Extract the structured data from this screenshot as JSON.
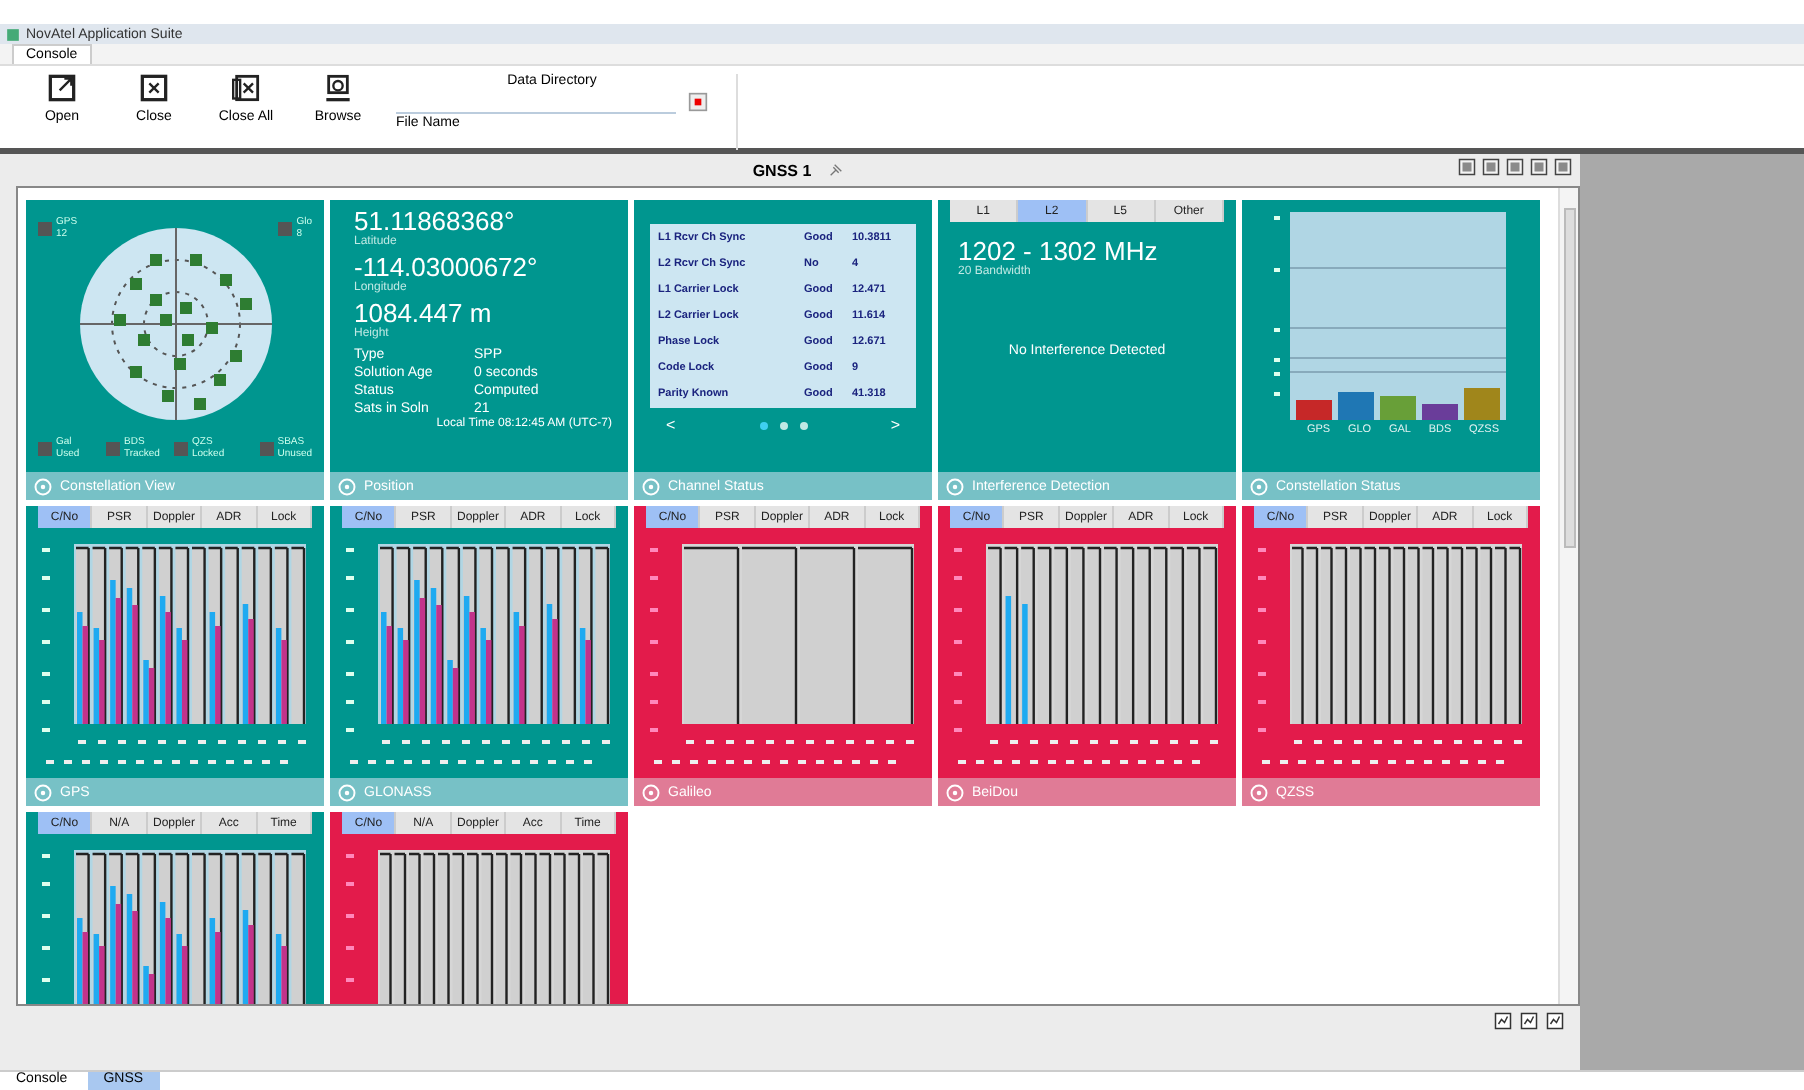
{
  "window": {
    "title": "NovAtel Application Suite"
  },
  "ribbon_tabs": [
    {
      "label": "Console",
      "selected": true
    }
  ],
  "toolbar": {
    "buttons": [
      {
        "label": "Open"
      },
      {
        "label": "Close"
      },
      {
        "label": "Close All"
      },
      {
        "label": "Browse"
      }
    ],
    "file_label": "File Name",
    "directory_label": "Data Directory"
  },
  "document": {
    "title": "GNSS 1"
  },
  "panels": [
    {
      "kind": "skyplot",
      "color": "#00968f",
      "footer": "Constellation View",
      "legend": [
        {
          "label": "GPS",
          "sub": "12"
        },
        {
          "label": "Glo",
          "sub": "8"
        },
        {
          "label": "Gal",
          "sub": "Used"
        },
        {
          "label": "BDS",
          "sub": "Tracked"
        },
        {
          "label": "QZS",
          "sub": "Locked"
        },
        {
          "label": "SBAS",
          "sub": "Unused"
        }
      ]
    },
    {
      "kind": "position",
      "color": "#00968f",
      "footer": "Position",
      "lat": "51.11868368°",
      "lat_label": "Latitude",
      "lon": "-114.03000672°",
      "lon_label": "Longitude",
      "height": "1084.447 m",
      "height_label": "Height",
      "rows": [
        {
          "key": "Type",
          "value": "SPP"
        },
        {
          "key": "Solution Age",
          "value": "0 seconds"
        },
        {
          "key": "Status",
          "value": "Computed"
        },
        {
          "key": "Sats in Soln",
          "value": "21"
        }
      ],
      "time": "Local Time 08:12:45 AM (UTC-7)"
    },
    {
      "kind": "channels",
      "color": "#00968f",
      "footer": "Channel Status",
      "rows": [
        [
          "L1 Rcvr Ch Sync",
          "Good",
          "10.3811"
        ],
        [
          "L2 Rcvr Ch Sync",
          "No",
          "4"
        ],
        [
          "L1 Carrier Lock",
          "Good",
          "12.471"
        ],
        [
          "L2 Carrier Lock",
          "Good",
          "11.614"
        ],
        [
          "Phase Lock",
          "Good",
          "12.671"
        ],
        [
          "Code Lock",
          "Good",
          "9"
        ],
        [
          "Parity Known",
          "Good",
          "41.318"
        ]
      ],
      "pager": {
        "prev": "<",
        "next": ">",
        "pages": [
          {
            "selected": true
          },
          {
            "selected": false
          },
          {
            "selected": false
          }
        ]
      }
    },
    {
      "kind": "interference",
      "color": "#00968f",
      "footer": "Interference Detection",
      "tabs": [
        {
          "label": "L1",
          "selected": false
        },
        {
          "label": "L2",
          "selected": true
        },
        {
          "label": "L5",
          "selected": false
        },
        {
          "label": "Other",
          "selected": false
        }
      ],
      "band": "1202 - 1302 MHz",
      "band_label": "20 Bandwidth",
      "message": "No Interference Detected"
    },
    {
      "kind": "bars",
      "color": "#00968f",
      "footer": "Constellation Status",
      "labels": [
        "GPS",
        "GLO",
        "GAL",
        "BDS",
        "QZSS"
      ]
    },
    {
      "kind": "signals",
      "color": "#00968f",
      "footer": "GPS",
      "tabs": [
        {
          "label": "C/No",
          "selected": true
        },
        {
          "label": "PSR",
          "selected": false
        },
        {
          "label": "Doppler",
          "selected": false
        },
        {
          "label": "ADR",
          "selected": false
        },
        {
          "label": "Lock",
          "selected": false
        }
      ]
    },
    {
      "kind": "signals",
      "color": "#00968f",
      "footer": "GLONASS",
      "tabs": [
        {
          "label": "C/No",
          "selected": true
        },
        {
          "label": "PSR",
          "selected": false
        },
        {
          "label": "Doppler",
          "selected": false
        },
        {
          "label": "ADR",
          "selected": false
        },
        {
          "label": "Lock",
          "selected": false
        }
      ]
    },
    {
      "kind": "signals",
      "color": "#e31b4b",
      "footer": "Galileo",
      "tabs": [
        {
          "label": "C/No",
          "selected": true
        },
        {
          "label": "PSR",
          "selected": false
        },
        {
          "label": "Doppler",
          "selected": false
        },
        {
          "label": "ADR",
          "selected": false
        },
        {
          "label": "Lock",
          "selected": false
        }
      ]
    },
    {
      "kind": "signals",
      "color": "#e31b4b",
      "footer": "BeiDou",
      "tabs": [
        {
          "label": "C/No",
          "selected": true
        },
        {
          "label": "PSR",
          "selected": false
        },
        {
          "label": "Doppler",
          "selected": false
        },
        {
          "label": "ADR",
          "selected": false
        },
        {
          "label": "Lock",
          "selected": false
        }
      ]
    },
    {
      "kind": "signals",
      "color": "#e31b4b",
      "footer": "QZSS",
      "tabs": [
        {
          "label": "C/No",
          "selected": true
        },
        {
          "label": "PSR",
          "selected": false
        },
        {
          "label": "Doppler",
          "selected": false
        },
        {
          "label": "ADR",
          "selected": false
        },
        {
          "label": "Lock",
          "selected": false
        }
      ]
    },
    {
      "kind": "signals",
      "color": "#00968f",
      "tabs": [
        {
          "label": "C/No",
          "selected": true
        },
        {
          "label": "N/A",
          "selected": false
        },
        {
          "label": "Doppler",
          "selected": false
        },
        {
          "label": "Acc",
          "selected": false
        },
        {
          "label": "Time",
          "selected": false
        }
      ]
    },
    {
      "kind": "signals",
      "color": "#e31b4b",
      "tabs": [
        {
          "label": "C/No",
          "selected": true
        },
        {
          "label": "N/A",
          "selected": false
        },
        {
          "label": "Doppler",
          "selected": false
        },
        {
          "label": "Acc",
          "selected": false
        },
        {
          "label": "Time",
          "selected": false
        }
      ]
    }
  ],
  "bottom_tabs": [
    {
      "label": "Console",
      "selected": false
    },
    {
      "label": "GNSS",
      "selected": true
    }
  ]
}
